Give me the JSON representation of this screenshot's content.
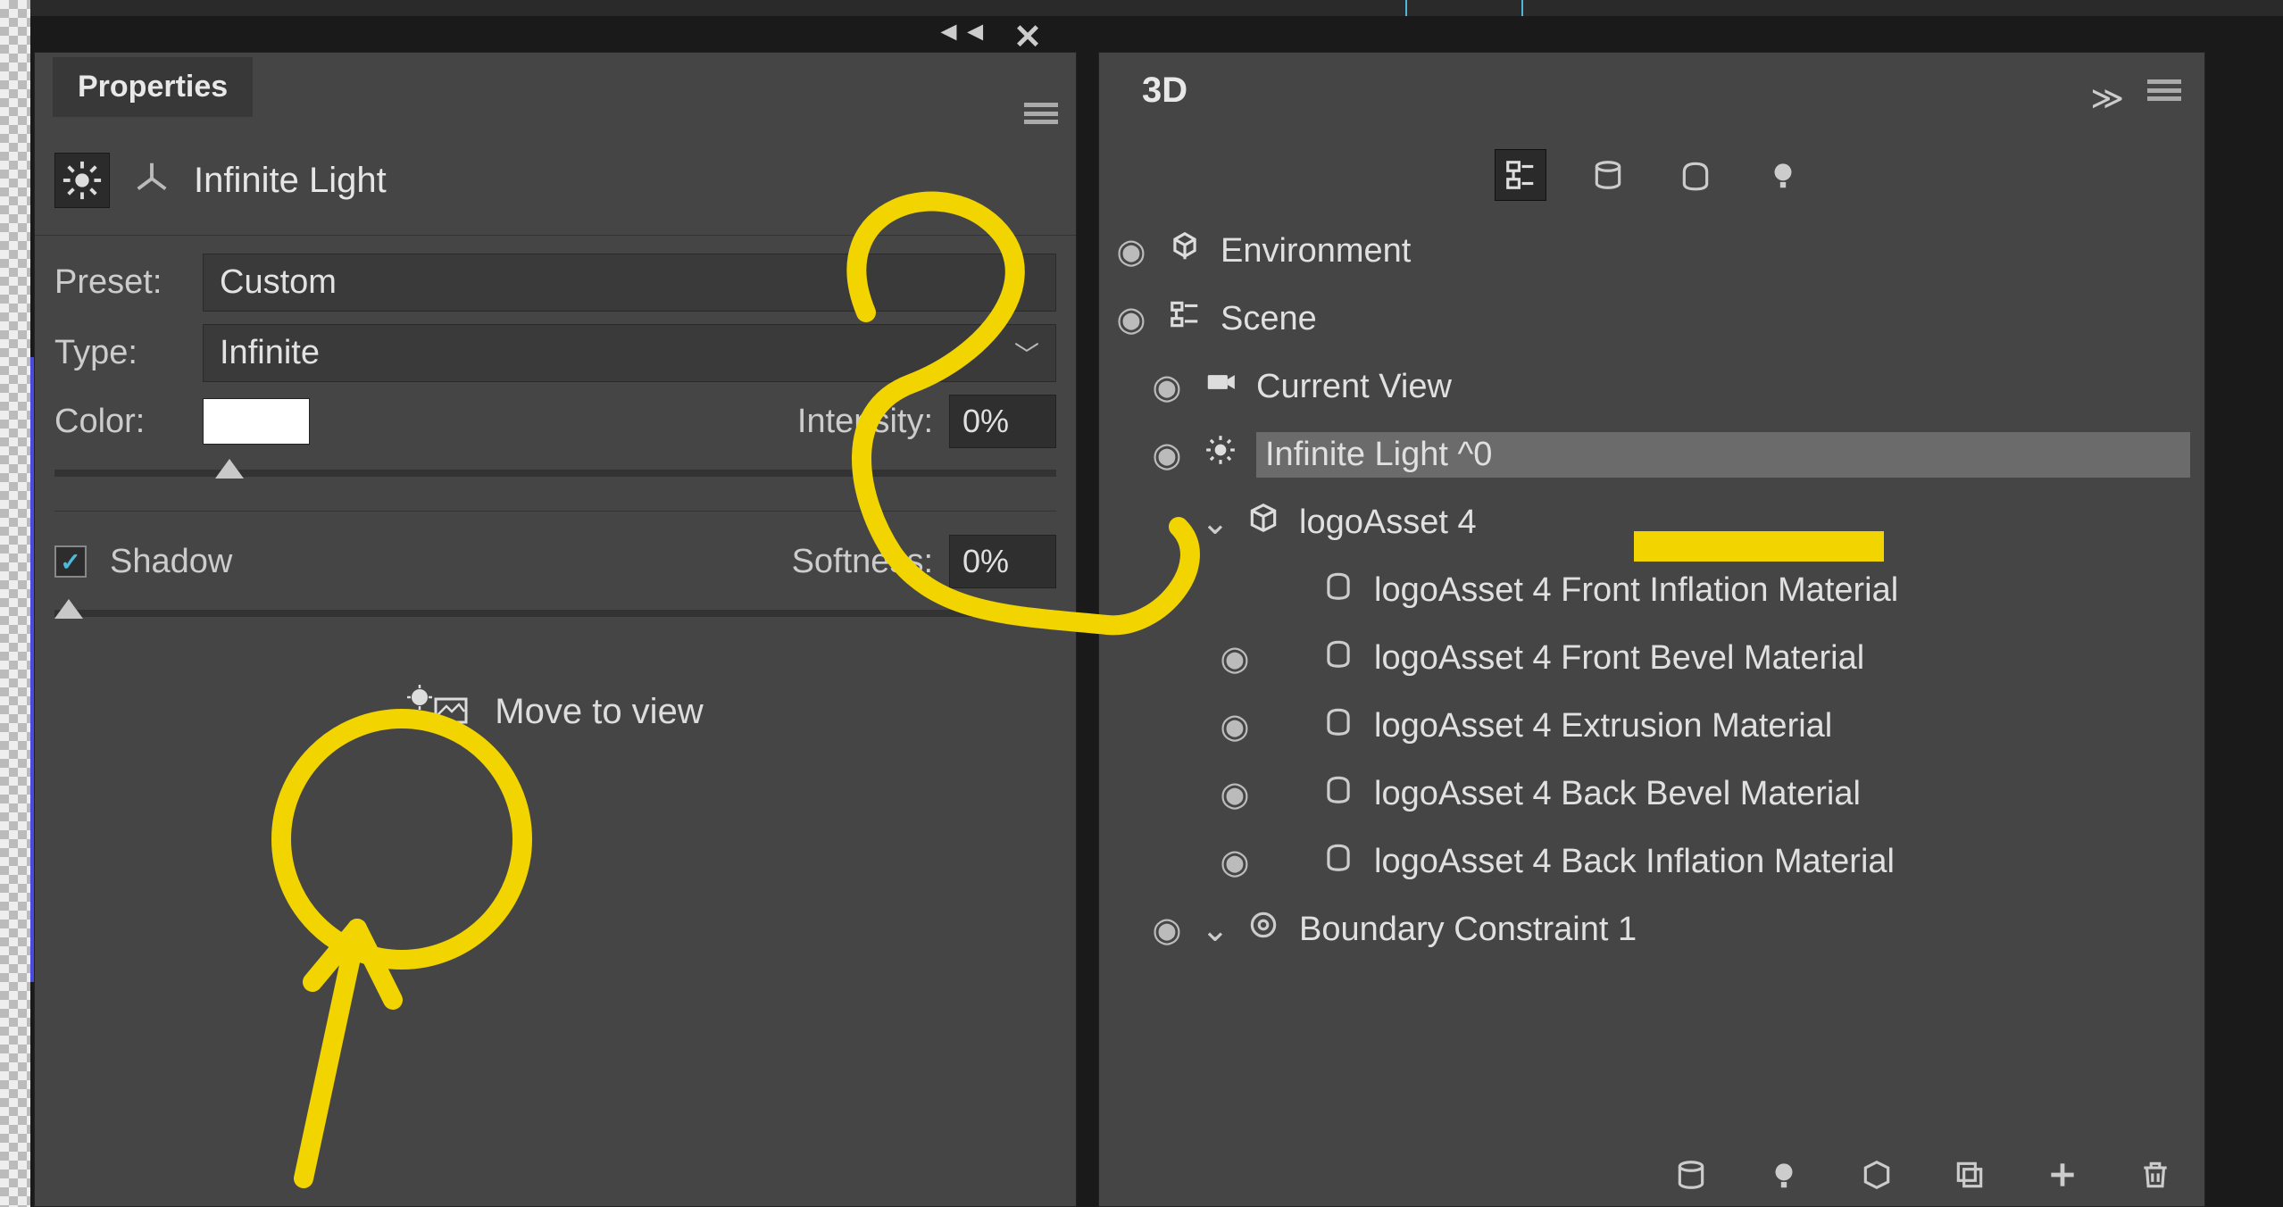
{
  "properties": {
    "panelTitle": "Properties",
    "objectTitle": "Infinite Light",
    "presetLabel": "Preset:",
    "presetValue": "Custom",
    "typeLabel": "Type:",
    "typeValue": "Infinite",
    "colorLabel": "Color:",
    "intensityLabel": "Intensity:",
    "intensityValue": "0%",
    "shadowLabel": "Shadow",
    "shadowChecked": "✓",
    "softnessLabel": "Softness:",
    "softnessValue": "0%",
    "moveToView": "Move to view"
  },
  "threeD": {
    "panelTitle": "3D",
    "items": {
      "environment": "Environment",
      "scene": "Scene",
      "currentView": "Current View",
      "infiniteLight": "Infinite Light ^0",
      "logoAsset": "logoAsset 4",
      "matFrontInfl": "logoAsset 4 Front Inflation Material",
      "matFrontBevel": "logoAsset 4 Front Bevel Material",
      "matExtrusion": "logoAsset 4 Extrusion Material",
      "matBackBevel": "logoAsset 4 Back Bevel Material",
      "matBackInfl": "logoAsset 4 Back Inflation Material",
      "boundary": "Boundary Constraint 1"
    }
  }
}
